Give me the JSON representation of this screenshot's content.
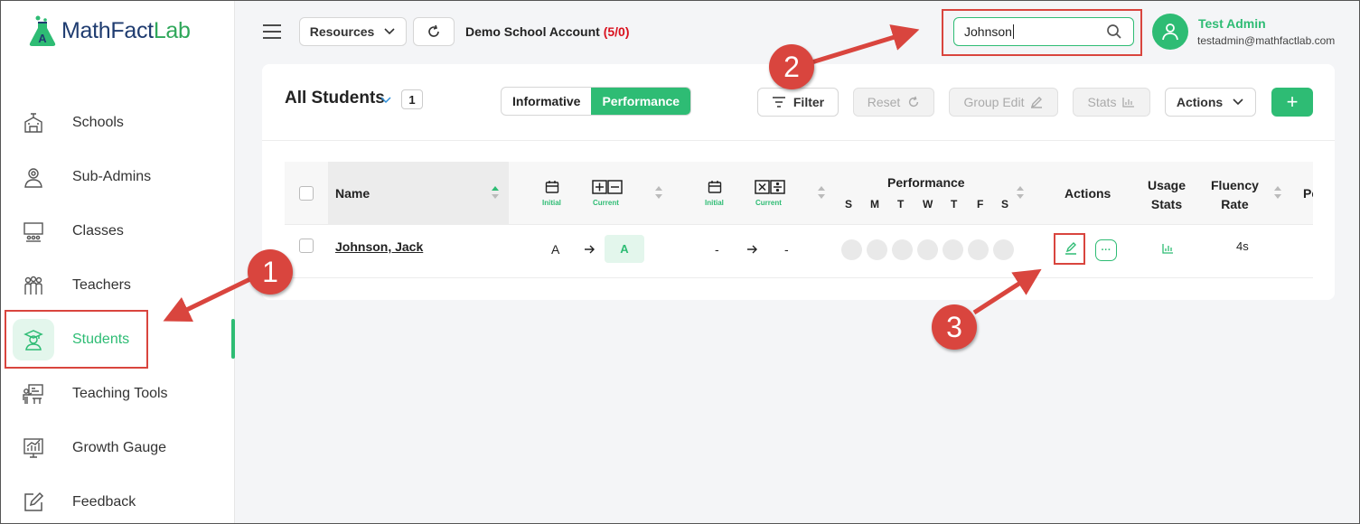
{
  "brand": {
    "logo_main": "MathFact",
    "logo_accent": "Lab"
  },
  "sidebar": {
    "items": [
      {
        "label": "Schools",
        "icon": "school-icon"
      },
      {
        "label": "Sub-Admins",
        "icon": "sub-admin-icon"
      },
      {
        "label": "Classes",
        "icon": "classroom-icon"
      },
      {
        "label": "Teachers",
        "icon": "teachers-icon"
      },
      {
        "label": "Students",
        "icon": "student-icon",
        "active": true
      },
      {
        "label": "Teaching Tools",
        "icon": "teaching-tools-icon"
      },
      {
        "label": "Growth Gauge",
        "icon": "growth-chart-icon"
      },
      {
        "label": "Feedback",
        "icon": "feedback-icon"
      }
    ]
  },
  "topbar": {
    "resources_label": "Resources",
    "school_name": "Demo School Account",
    "school_count": "(5/0)",
    "search_value": "Johnson",
    "user_name": "Test Admin",
    "user_email": "testadmin@mathfactlab.com"
  },
  "toolbar": {
    "title": "All Students",
    "count": "1",
    "toggle_informative": "Informative",
    "toggle_performance": "Performance",
    "filter_label": "Filter",
    "reset_label": "Reset",
    "group_edit_label": "Group Edit",
    "stats_label": "Stats",
    "actions_label": "Actions",
    "add_label": "+"
  },
  "table": {
    "headers": {
      "name": "Name",
      "initial": "Initial",
      "current": "Current",
      "performance": "Performance",
      "days": [
        "S",
        "M",
        "T",
        "W",
        "T",
        "F",
        "S"
      ],
      "actions": "Actions",
      "usage_line1": "Usage",
      "usage_line2": "Stats",
      "fluency_line1": "Fluency",
      "fluency_line2": "Rate",
      "cut_off": "Pe"
    },
    "rows": [
      {
        "name": "Johnson, Jack",
        "addsub_initial": "A",
        "addsub_current": "A",
        "muldiv_initial": "-",
        "muldiv_current": "-",
        "fluency_rate": "4s",
        "more_label": "···"
      }
    ]
  },
  "annotations": {
    "marker_1": "1",
    "marker_2": "2",
    "marker_3": "3"
  },
  "colors": {
    "accent": "#2ebc74",
    "brand_navy": "#1f3c70",
    "annotation_red": "#d9453e",
    "count_red": "#d9121f"
  }
}
